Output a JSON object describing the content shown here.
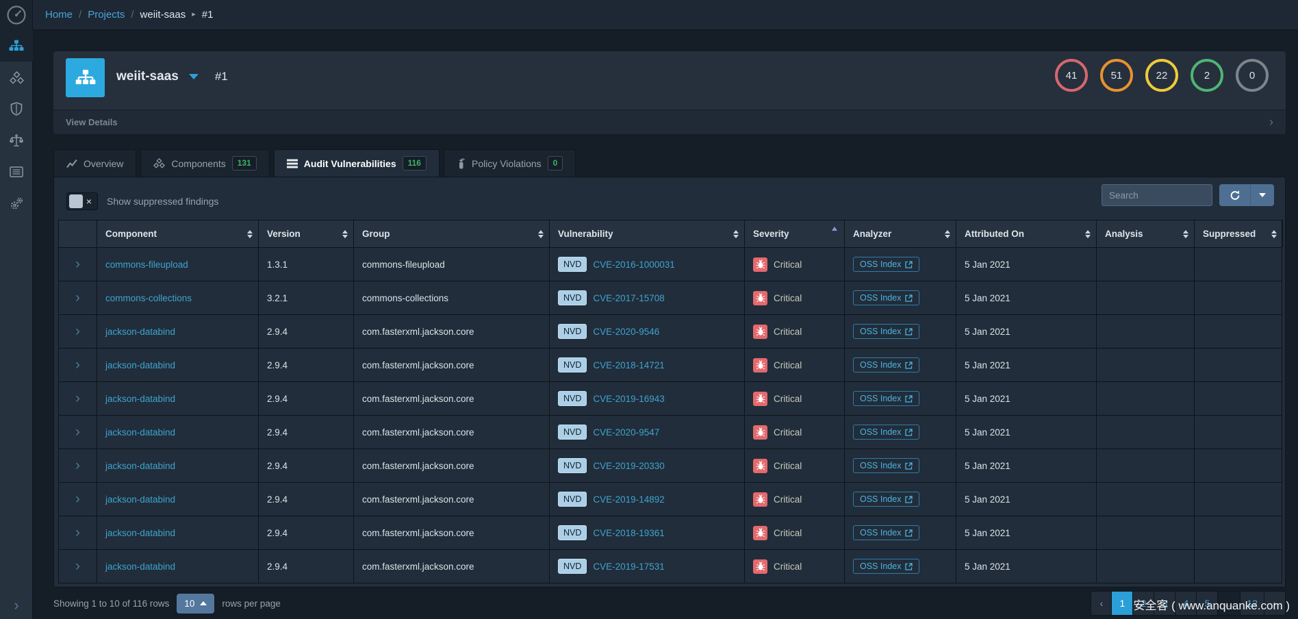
{
  "icons": {
    "breadcrumb_sep": "/",
    "breadcrumb_caret": "▸",
    "expand": "›",
    "view_details_chevron": "›",
    "sidebar_expand": "›",
    "toggle_off": "×"
  },
  "colors": {
    "accent_blue": "#2d9fd8",
    "link_blue": "#3fa3cf",
    "severity_critical_badge": "#e4696d",
    "tab_badge_green": "#3eb260"
  },
  "navbar": {
    "breadcrumb": {
      "home": "Home",
      "projects": "Projects",
      "project": "weiit-saas",
      "version": "#1"
    }
  },
  "sidebar": {
    "icons": [
      "sitemap",
      "cubes",
      "shield",
      "balance-scale",
      "list",
      "gears"
    ]
  },
  "project": {
    "name": "weiit-saas",
    "version": "#1",
    "metrics": [
      {
        "value": "41",
        "color": "#d4686f"
      },
      {
        "value": "51",
        "color": "#e8922f"
      },
      {
        "value": "22",
        "color": "#eecb39"
      },
      {
        "value": "2",
        "color": "#4eb573"
      },
      {
        "value": "0",
        "color": "#7c858c"
      }
    ],
    "view_details": "View Details"
  },
  "tabs": [
    {
      "label": "Overview"
    },
    {
      "label": "Components",
      "badge": "131"
    },
    {
      "label": "Audit Vulnerabilities",
      "badge": "116",
      "active": true
    },
    {
      "label": "Policy Violations",
      "badge": "0"
    }
  ],
  "toolbar": {
    "suppressed_label": "Show suppressed findings",
    "search_placeholder": "Search"
  },
  "table": {
    "columns": [
      {
        "label": ""
      },
      {
        "label": "Component",
        "sort": "both"
      },
      {
        "label": "Version",
        "sort": "both"
      },
      {
        "label": "Group",
        "sort": "both"
      },
      {
        "label": "Vulnerability",
        "sort": "both"
      },
      {
        "label": "Severity",
        "sort": "asc"
      },
      {
        "label": "Analyzer",
        "sort": "both"
      },
      {
        "label": "Attributed On",
        "sort": "both"
      },
      {
        "label": "Analysis",
        "sort": "both"
      },
      {
        "label": "Suppressed",
        "sort": "both"
      }
    ],
    "rows": [
      {
        "component": "commons-fileupload",
        "version": "1.3.1",
        "group": "commons-fileupload",
        "source": "NVD",
        "vuln": "CVE-2016-1000031",
        "severity": "Critical",
        "analyzer": "OSS Index",
        "attributed": "5 Jan 2021",
        "analysis": "",
        "suppressed": ""
      },
      {
        "component": "commons-collections",
        "version": "3.2.1",
        "group": "commons-collections",
        "source": "NVD",
        "vuln": "CVE-2017-15708",
        "severity": "Critical",
        "analyzer": "OSS Index",
        "attributed": "5 Jan 2021",
        "analysis": "",
        "suppressed": ""
      },
      {
        "component": "jackson-databind",
        "version": "2.9.4",
        "group": "com.fasterxml.jackson.core",
        "source": "NVD",
        "vuln": "CVE-2020-9546",
        "severity": "Critical",
        "analyzer": "OSS Index",
        "attributed": "5 Jan 2021",
        "analysis": "",
        "suppressed": ""
      },
      {
        "component": "jackson-databind",
        "version": "2.9.4",
        "group": "com.fasterxml.jackson.core",
        "source": "NVD",
        "vuln": "CVE-2018-14721",
        "severity": "Critical",
        "analyzer": "OSS Index",
        "attributed": "5 Jan 2021",
        "analysis": "",
        "suppressed": ""
      },
      {
        "component": "jackson-databind",
        "version": "2.9.4",
        "group": "com.fasterxml.jackson.core",
        "source": "NVD",
        "vuln": "CVE-2019-16943",
        "severity": "Critical",
        "analyzer": "OSS Index",
        "attributed": "5 Jan 2021",
        "analysis": "",
        "suppressed": ""
      },
      {
        "component": "jackson-databind",
        "version": "2.9.4",
        "group": "com.fasterxml.jackson.core",
        "source": "NVD",
        "vuln": "CVE-2020-9547",
        "severity": "Critical",
        "analyzer": "OSS Index",
        "attributed": "5 Jan 2021",
        "analysis": "",
        "suppressed": ""
      },
      {
        "component": "jackson-databind",
        "version": "2.9.4",
        "group": "com.fasterxml.jackson.core",
        "source": "NVD",
        "vuln": "CVE-2019-20330",
        "severity": "Critical",
        "analyzer": "OSS Index",
        "attributed": "5 Jan 2021",
        "analysis": "",
        "suppressed": ""
      },
      {
        "component": "jackson-databind",
        "version": "2.9.4",
        "group": "com.fasterxml.jackson.core",
        "source": "NVD",
        "vuln": "CVE-2019-14892",
        "severity": "Critical",
        "analyzer": "OSS Index",
        "attributed": "5 Jan 2021",
        "analysis": "",
        "suppressed": ""
      },
      {
        "component": "jackson-databind",
        "version": "2.9.4",
        "group": "com.fasterxml.jackson.core",
        "source": "NVD",
        "vuln": "CVE-2018-19361",
        "severity": "Critical",
        "analyzer": "OSS Index",
        "attributed": "5 Jan 2021",
        "analysis": "",
        "suppressed": ""
      },
      {
        "component": "jackson-databind",
        "version": "2.9.4",
        "group": "com.fasterxml.jackson.core",
        "source": "NVD",
        "vuln": "CVE-2019-17531",
        "severity": "Critical",
        "analyzer": "OSS Index",
        "attributed": "5 Jan 2021",
        "analysis": "",
        "suppressed": ""
      }
    ]
  },
  "footer": {
    "showing": "Showing 1 to 10 of 116 rows",
    "page_size": "10",
    "rows_per_page_label": "rows per page",
    "pages": [
      {
        "label": "‹",
        "type": "prev"
      },
      {
        "label": "1",
        "active": true
      },
      {
        "label": "2"
      },
      {
        "label": "3"
      },
      {
        "label": "4"
      },
      {
        "label": "5"
      },
      {
        "label": "…",
        "type": "ellipsis"
      },
      {
        "label": "12"
      },
      {
        "label": "›",
        "type": "next"
      }
    ]
  },
  "watermark": "安全客 ( www.anquanke.com )"
}
